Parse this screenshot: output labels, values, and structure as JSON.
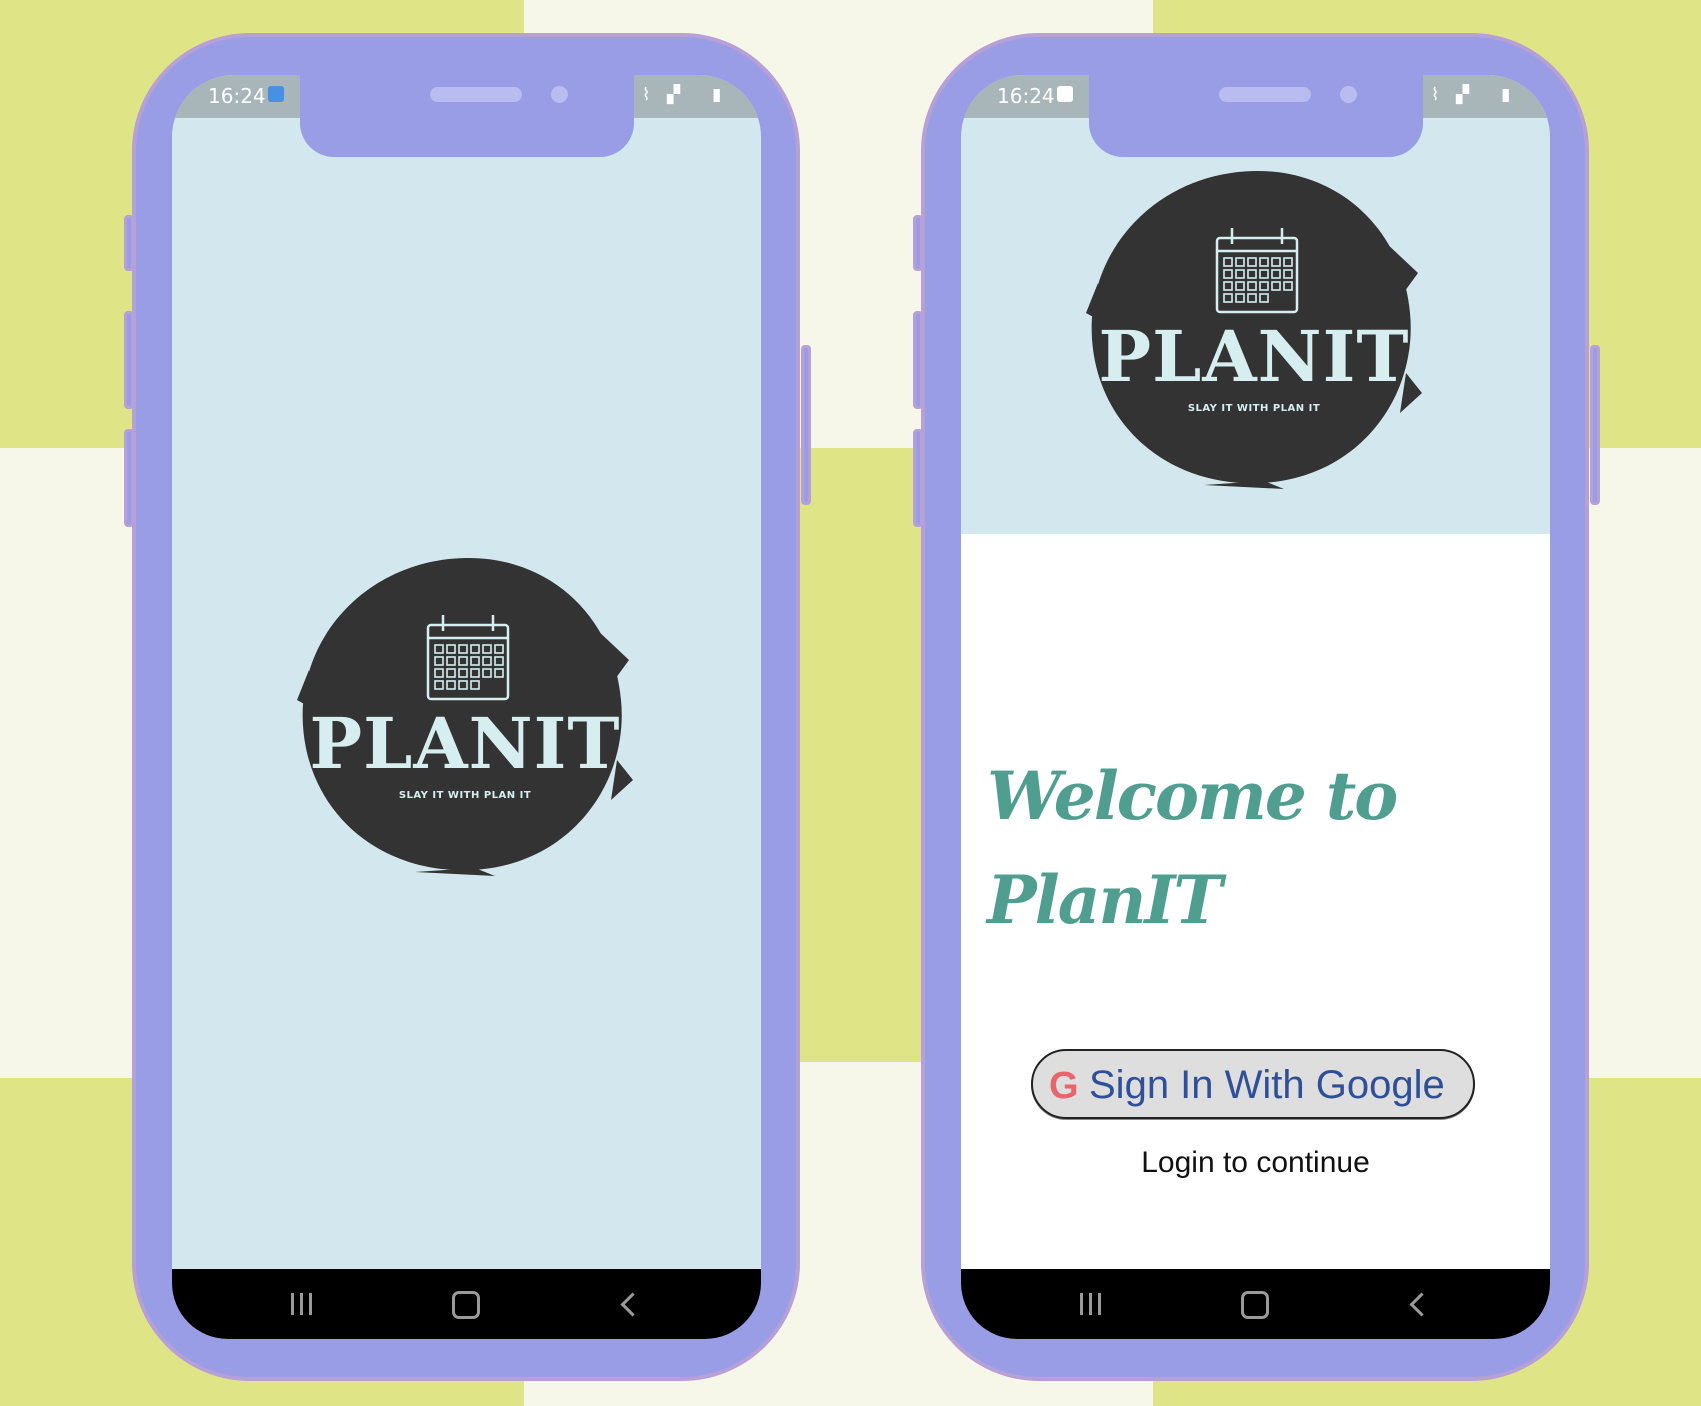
{
  "background": {
    "cream": "#f7f7e9",
    "green": "#dfe587",
    "phone_body": "#989de6",
    "phone_border": "#b79fd8"
  },
  "splash_phone": {
    "status_time": "16:24",
    "logo": {
      "title": "PLANIT",
      "tagline": "SLAY IT WITH PLAN IT",
      "icon": "calendar-icon"
    },
    "nav": {
      "recent_icon": "recent-apps-icon",
      "home_icon": "home-icon",
      "back_icon": "back-icon"
    }
  },
  "login_phone": {
    "status_time": "16:24",
    "logo": {
      "title": "PLANIT",
      "tagline": "SLAY IT WITH PLAN IT",
      "icon": "calendar-icon"
    },
    "welcome_line1": "Welcome to",
    "welcome_line2": "PlanIT",
    "welcome_color": "#4f9e8f",
    "google_button": {
      "icon_letter": "G",
      "label": "Sign In With Google",
      "icon_color": "#e8656b",
      "label_color": "#2f4f98"
    },
    "login_hint": "Login to continue",
    "nav": {
      "recent_icon": "recent-apps-icon",
      "home_icon": "home-icon",
      "back_icon": "back-icon"
    }
  }
}
